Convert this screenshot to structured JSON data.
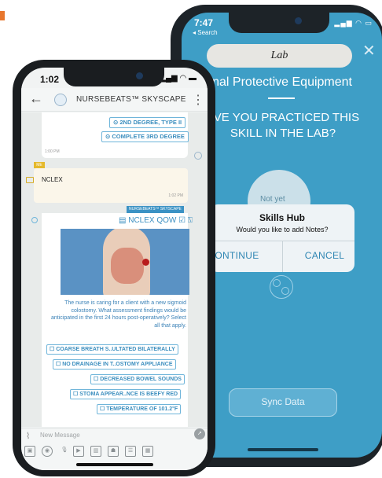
{
  "back_phone": {
    "status_time": "7:47",
    "status_back": "◂ Search",
    "lab_label": "Lab",
    "section_title": "ersonal Protective Equipment",
    "question": "AVE YOU PRACTICED THIS SKILL IN THE LAB?",
    "not_yet": "Not yet",
    "dialog": {
      "title": "Skills Hub",
      "message": "Would you like to add Notes?",
      "continue": "CONTINUE",
      "cancel": "CANCEL"
    },
    "sync_button": "Sync Data"
  },
  "front_phone": {
    "status_time": "1:02",
    "header_title": "NURSEBEATS™ SKYSCAPE",
    "card_chips": [
      "⊙ 2ND DEGREE, TYPE II",
      "⊙ COMPLETE 3RD DEGREE"
    ],
    "card_time": "1:00 PM",
    "me_tag": "ME",
    "sent_message": "NCLEX",
    "sent_time": "1:02 PM",
    "sender_tag": "NURSEBEATS™ SKYSCAPE",
    "qow_title": "▤ NCLEX QOW ☑ ⍂",
    "question_text": "The nurse is caring for a client with a new sigmoid colostomy. What assessment findings would be anticipated in the first 24 hours post-operatively? Select all that apply.",
    "options": [
      "☐ COARSE BREATH S..ULTATED BILATERALLY",
      "☐ NO DRAINAGE IN T..OSTOMY APPLIANCE",
      "☐ DECREASED BOWEL SOUNDS",
      "☐ STOMA APPEAR..NCE IS BEEFY RED",
      "☐ TEMPERATURE OF 101.2°F"
    ],
    "input_placeholder": "New Message"
  }
}
